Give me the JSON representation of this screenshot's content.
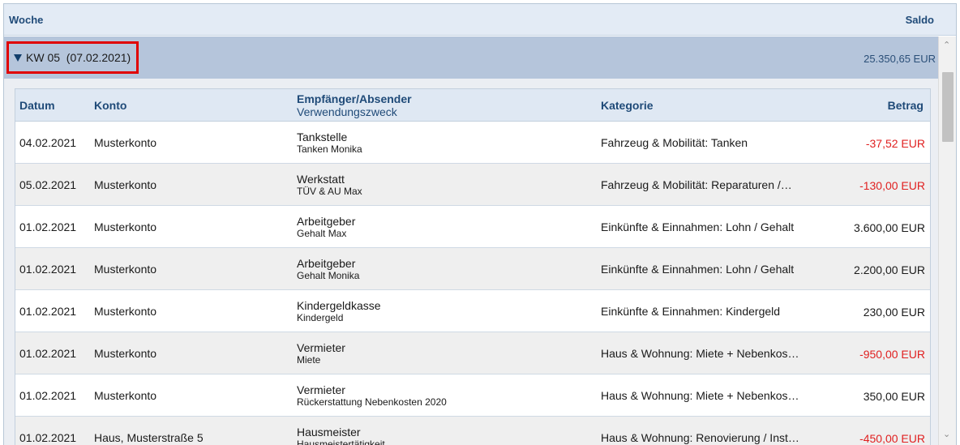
{
  "header": {
    "woche_label": "Woche",
    "saldo_label": "Saldo"
  },
  "week": {
    "label": "KW 05  (07.02.2021)",
    "saldo": "25.350,65 EUR",
    "expanded": true
  },
  "table": {
    "columns": {
      "datum": "Datum",
      "konto": "Konto",
      "empfaenger": "Empfänger/Absender",
      "verwendungszweck": "Verwendungszweck",
      "kategorie": "Kategorie",
      "betrag": "Betrag"
    },
    "rows": [
      {
        "datum": "04.02.2021",
        "konto": "Musterkonto",
        "empfaenger": "Tankstelle",
        "zweck": "Tanken Monika",
        "kategorie": "Fahrzeug & Mobilität: Tanken",
        "betrag": "-37,52 EUR",
        "negative": true
      },
      {
        "datum": "05.02.2021",
        "konto": "Musterkonto",
        "empfaenger": "Werkstatt",
        "zweck": "TÜV & AU Max",
        "kategorie": "Fahrzeug & Mobilität: Reparaturen /…",
        "betrag": "-130,00 EUR",
        "negative": true
      },
      {
        "datum": "01.02.2021",
        "konto": "Musterkonto",
        "empfaenger": "Arbeitgeber",
        "zweck": "Gehalt Max",
        "kategorie": "Einkünfte & Einnahmen: Lohn / Gehalt",
        "betrag": "3.600,00 EUR",
        "negative": false
      },
      {
        "datum": "01.02.2021",
        "konto": "Musterkonto",
        "empfaenger": "Arbeitgeber",
        "zweck": "Gehalt Monika",
        "kategorie": "Einkünfte & Einnahmen: Lohn / Gehalt",
        "betrag": "2.200,00 EUR",
        "negative": false
      },
      {
        "datum": "01.02.2021",
        "konto": "Musterkonto",
        "empfaenger": "Kindergeldkasse",
        "zweck": "Kindergeld",
        "kategorie": "Einkünfte & Einnahmen: Kindergeld",
        "betrag": "230,00 EUR",
        "negative": false
      },
      {
        "datum": "01.02.2021",
        "konto": "Musterkonto",
        "empfaenger": "Vermieter",
        "zweck": "Miete",
        "kategorie": "Haus & Wohnung: Miete + Nebenkos…",
        "betrag": "-950,00 EUR",
        "negative": true
      },
      {
        "datum": "01.02.2021",
        "konto": "Musterkonto",
        "empfaenger": "Vermieter",
        "zweck": "Rückerstattung Nebenkosten 2020",
        "kategorie": "Haus & Wohnung: Miete + Nebenkos…",
        "betrag": "350,00 EUR",
        "negative": false
      },
      {
        "datum": "01.02.2021",
        "konto": "Haus, Musterstraße 5",
        "empfaenger": "Hausmeister",
        "zweck": "Hausmeistertätigkeit",
        "kategorie": "Haus & Wohnung: Renovierung / Inst…",
        "betrag": "-450,00 EUR",
        "negative": true
      }
    ]
  },
  "colors": {
    "negative": "#e02020",
    "header_text": "#1f4a78",
    "week_bg": "#b5c5db",
    "highlight_border": "#e00000"
  },
  "icons": {
    "expand": "triangle-down-icon",
    "scroll_up": "chevron-up-icon",
    "scroll_down": "chevron-down-icon"
  }
}
